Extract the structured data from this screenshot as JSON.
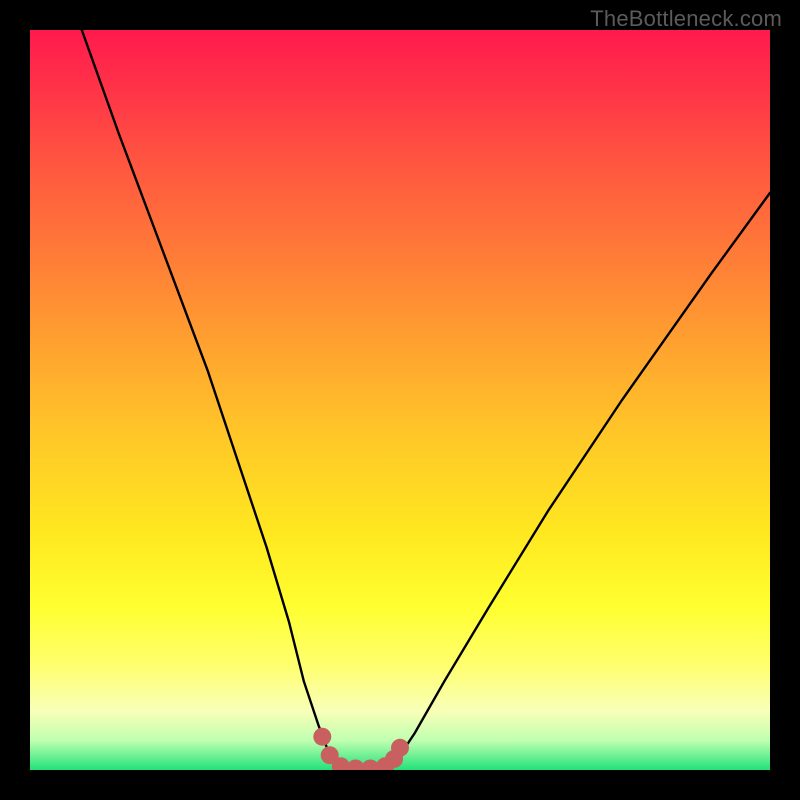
{
  "watermark": "TheBottleneck.com",
  "chart_data": {
    "type": "line",
    "title": "",
    "xlabel": "",
    "ylabel": "",
    "xlim": [
      0,
      100
    ],
    "ylim": [
      0,
      100
    ],
    "series": [
      {
        "name": "bottleneck-curve",
        "x": [
          7,
          12,
          18,
          24,
          28,
          32,
          35,
          37,
          39,
          40.5,
          42,
          44,
          46,
          48,
          50,
          52,
          56,
          62,
          70,
          80,
          92,
          100
        ],
        "y": [
          100,
          86,
          70,
          54,
          42,
          30,
          20,
          12,
          6,
          2,
          0,
          0,
          0,
          0.5,
          2,
          5,
          12,
          22,
          35,
          50,
          67,
          78
        ]
      }
    ],
    "markers": {
      "name": "highlight-dots",
      "color": "#c86060",
      "points": [
        {
          "x": 39.5,
          "y": 4.5
        },
        {
          "x": 40.5,
          "y": 2.0
        },
        {
          "x": 42.0,
          "y": 0.5
        },
        {
          "x": 44.0,
          "y": 0.2
        },
        {
          "x": 46.0,
          "y": 0.2
        },
        {
          "x": 48.0,
          "y": 0.5
        },
        {
          "x": 49.2,
          "y": 1.5
        },
        {
          "x": 50.0,
          "y": 3.0
        }
      ]
    }
  }
}
